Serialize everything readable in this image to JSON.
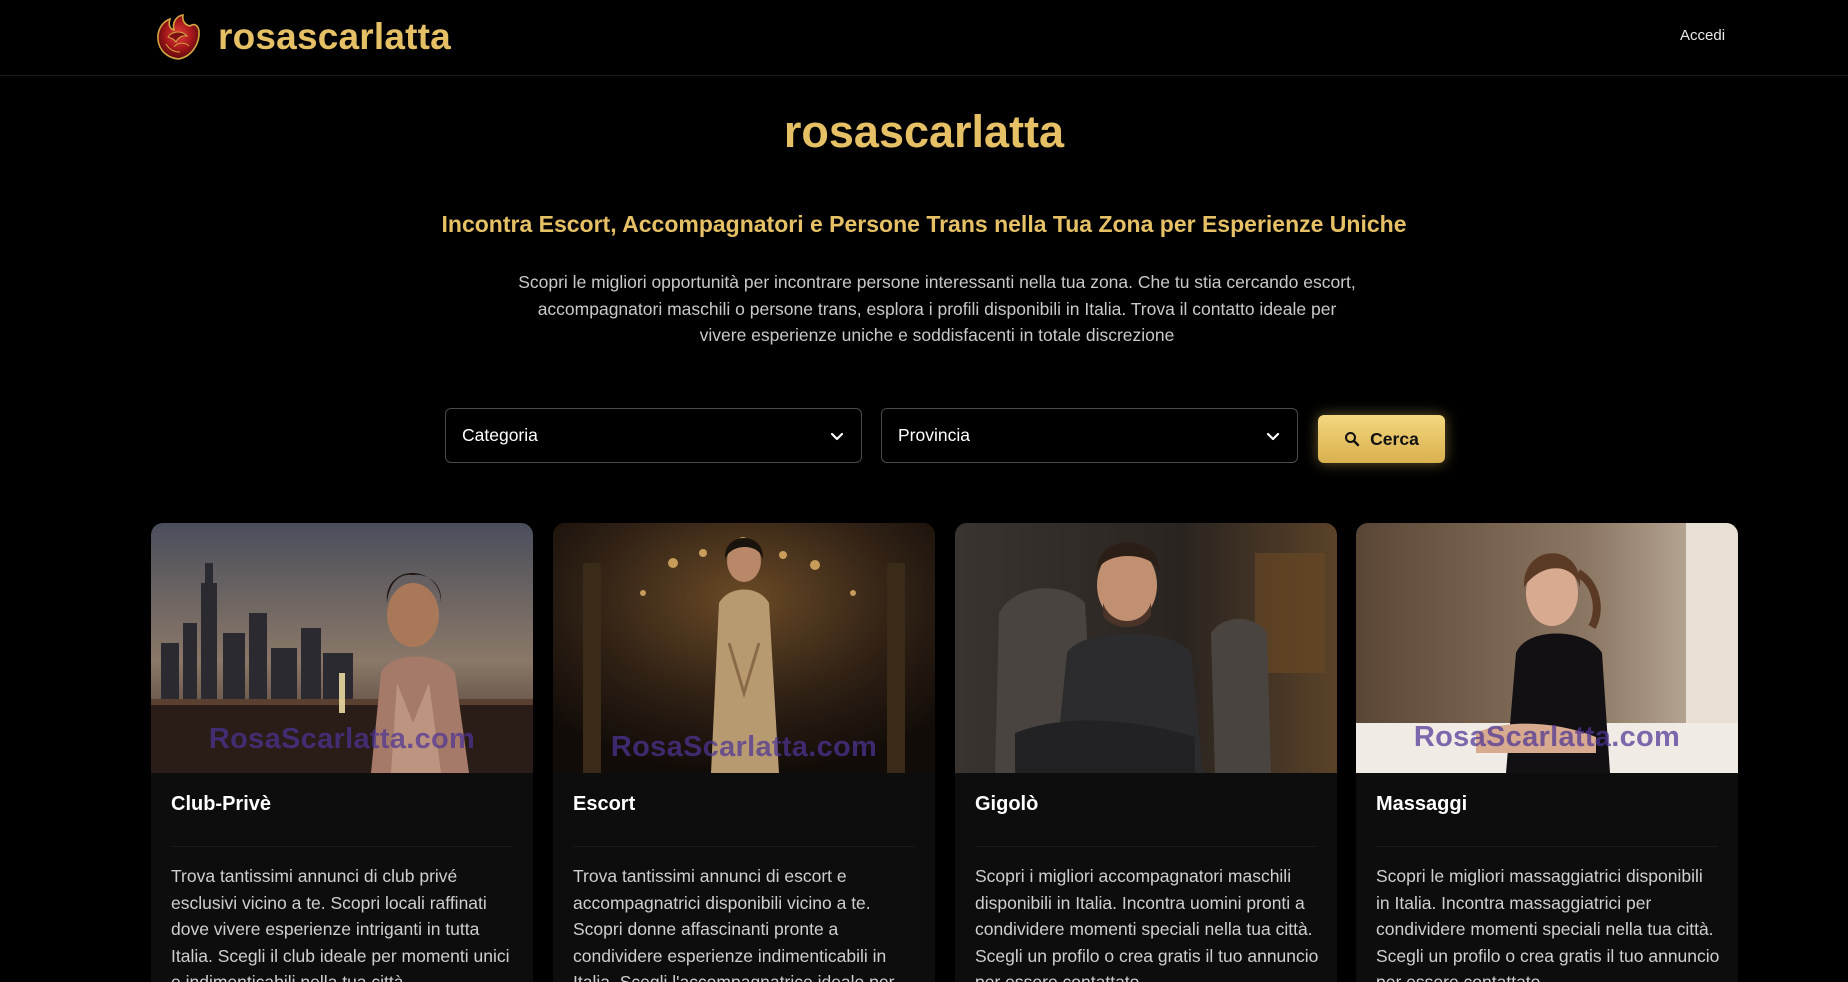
{
  "header": {
    "brand": "rosascarlatta",
    "logo_icon": "rose-icon",
    "login_label": "Accedi"
  },
  "hero": {
    "title": "rosascarlatta",
    "subtitle": "Incontra Escort, Accompagnatori e Persone Trans nella Tua Zona per Esperienze Uniche",
    "description": "Scopri le migliori opportunità per incontrare persone interessanti nella tua zona. Che tu stia cercando escort, accompagnatori maschili o persone trans, esplora i profili disponibili in Italia. Trova il contatto ideale per vivere esperienze uniche e soddisfacenti in totale discrezione"
  },
  "search": {
    "category_selected": "Categoria",
    "province_selected": "Provincia",
    "button_label": "Cerca",
    "button_icon": "search-icon"
  },
  "cards": [
    {
      "title": "Club-Privè",
      "watermark": "RosaScarlatta.com",
      "text": "Trova tantissimi annunci di club privé esclusivi vicino a te. Scopri locali raffinati dove vivere esperienze intriganti in tutta Italia. Scegli il club ideale per momenti unici e indimenticabili nella tua città."
    },
    {
      "title": "Escort",
      "watermark": "RosaScarlatta.com",
      "text": "Trova tantissimi annunci di escort e accompagnatrici disponibili vicino a te. Scopri donne affascinanti pronte a condividere esperienze indimenticabili in Italia. Scegli l'accompagnatrice ideale per"
    },
    {
      "title": "Gigolò",
      "watermark": "",
      "text": "Scopri i migliori accompagnatori maschili disponibili in Italia. Incontra uomini pronti a condividere momenti speciali nella tua città. Scegli un profilo o crea gratis il tuo annuncio per essere contattato."
    },
    {
      "title": "Massaggi",
      "watermark": "RosaScarlatta.com",
      "text": "Scopri le migliori massaggiatrici disponibili in Italia. Incontra massaggiatrici per condividere momenti speciali nella tua città. Scegli un profilo o crea gratis il tuo annuncio per essere contattato."
    }
  ],
  "colors": {
    "background": "#000000",
    "accent_gold": "#e6c065",
    "card_bg": "#0d0d0d",
    "text_muted": "#cfcfcf"
  }
}
